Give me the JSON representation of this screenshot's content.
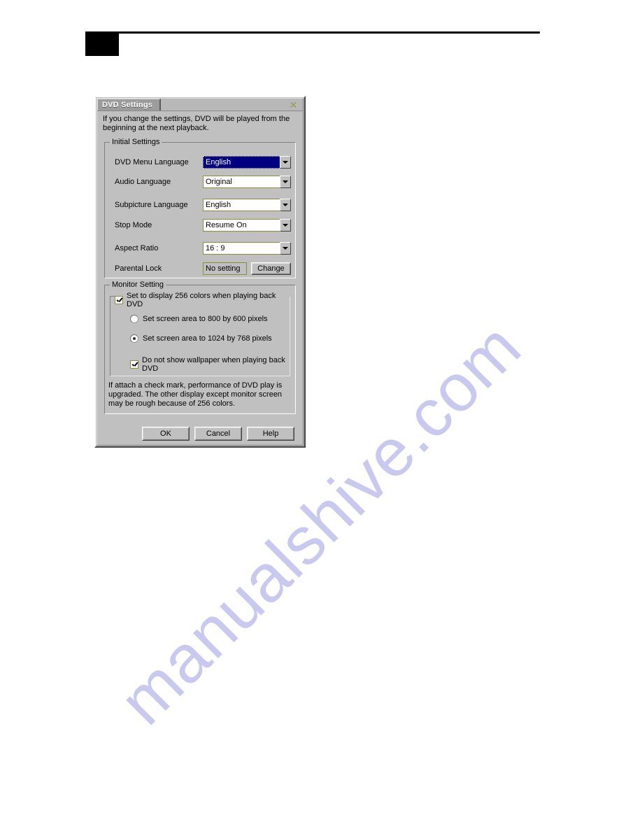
{
  "page": {
    "watermark": "manualshive.com"
  },
  "dialog": {
    "title": "DVD Settings",
    "close_icon": "close-icon",
    "intro": "If you change the settings, DVD will be played from the beginning at the next playback.",
    "initial_settings": {
      "legend": "Initial Settings",
      "rows": [
        {
          "label": "DVD Menu Language",
          "value": "English",
          "control": "combobox",
          "selected": true
        },
        {
          "label": "Audio Language",
          "value": "Original",
          "control": "combobox",
          "selected": false
        },
        {
          "label": "Subpicture Language",
          "value": "English",
          "control": "combobox",
          "selected": false
        },
        {
          "label": "Stop Mode",
          "value": "Resume On",
          "control": "combobox",
          "selected": false
        },
        {
          "label": "Aspect Ratio",
          "value": "16 : 9",
          "control": "combobox",
          "selected": false
        },
        {
          "label": "Parental Lock",
          "value": "No setting",
          "control": "readonly-value",
          "button_label": "Change"
        }
      ]
    },
    "monitor_setting": {
      "legend": "Monitor Setting",
      "color_checkbox": {
        "label": "Set to display 256 colors when playing back DVD",
        "checked": true
      },
      "radios": [
        {
          "label": "Set screen area to 800 by 600 pixels",
          "checked": false
        },
        {
          "label": "Set screen area to 1024 by 768 pixels",
          "checked": true
        }
      ],
      "wallpaper_checkbox": {
        "label": "Do not show wallpaper when playing back DVD",
        "checked": true
      },
      "note": "If attach a check mark, performance of DVD play is upgraded. The other display except monitor screen may be rough because of 256 colors."
    },
    "buttons": {
      "ok": "OK",
      "cancel": "Cancel",
      "help": "Help"
    }
  },
  "colors": {
    "dialog_face": "#c0c0c0",
    "titlebar": "#b8b8b8",
    "title_tab": "#9c9c9c",
    "selection": "#000080",
    "field_border": "#8d8d3e",
    "close_icon": "#9a9a55",
    "watermark": "#c9c9ef",
    "rule": "#000000"
  }
}
